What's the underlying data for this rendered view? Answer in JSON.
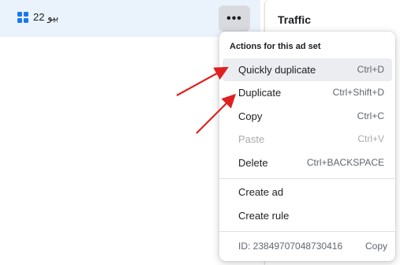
{
  "row": {
    "label": "بيو 22",
    "icon": "grid-icon",
    "more_label": "•••"
  },
  "side_panel": {
    "title": "Traffic"
  },
  "menu": {
    "header": "Actions for this ad set",
    "items": [
      {
        "label": "Quickly duplicate",
        "shortcut": "Ctrl+D",
        "highlighted": true
      },
      {
        "label": "Duplicate",
        "shortcut": "Ctrl+Shift+D"
      },
      {
        "label": "Copy",
        "shortcut": "Ctrl+C"
      },
      {
        "label": "Paste",
        "shortcut": "Ctrl+V",
        "disabled": true
      },
      {
        "label": "Delete",
        "shortcut": "Ctrl+BACKSPACE"
      }
    ],
    "secondary_items": [
      {
        "label": "Create ad"
      },
      {
        "label": "Create rule"
      }
    ],
    "id_text": "ID: 23849707048730416",
    "copy_label": "Copy"
  },
  "colors": {
    "accent": "#1877f2",
    "highlight": "#ebedf0",
    "row_background": "#eaf3fb",
    "annotation_arrow": "#e02020"
  }
}
